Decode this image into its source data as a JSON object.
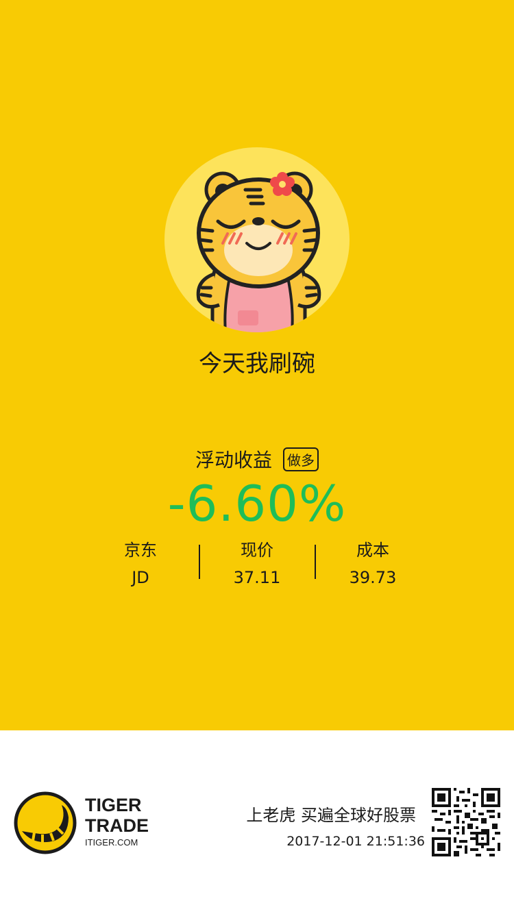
{
  "colors": {
    "background": "#f8cb04",
    "avatar_circle": "#fde35b",
    "return_negative": "#1ebd59",
    "text": "#1b1b1b"
  },
  "avatar": {
    "icon": "tiger-mascot-avatar"
  },
  "mood_text": "今天我刷碗",
  "position": {
    "label": "浮动收益",
    "direction_badge": "做多",
    "return_pct": "-6.60%"
  },
  "stats": [
    {
      "label": "京东",
      "value": "JD"
    },
    {
      "label": "现价",
      "value": "37.11"
    },
    {
      "label": "成本",
      "value": "39.73"
    }
  ],
  "footer": {
    "brand_line1": "TIGER",
    "brand_line2": "TRADE",
    "brand_url": "ITIGER.COM",
    "slogan": "上老虎 买遍全球好股票",
    "timestamp": "2017-12-01 21:51:36",
    "qr_icon": "qr-code-icon"
  }
}
